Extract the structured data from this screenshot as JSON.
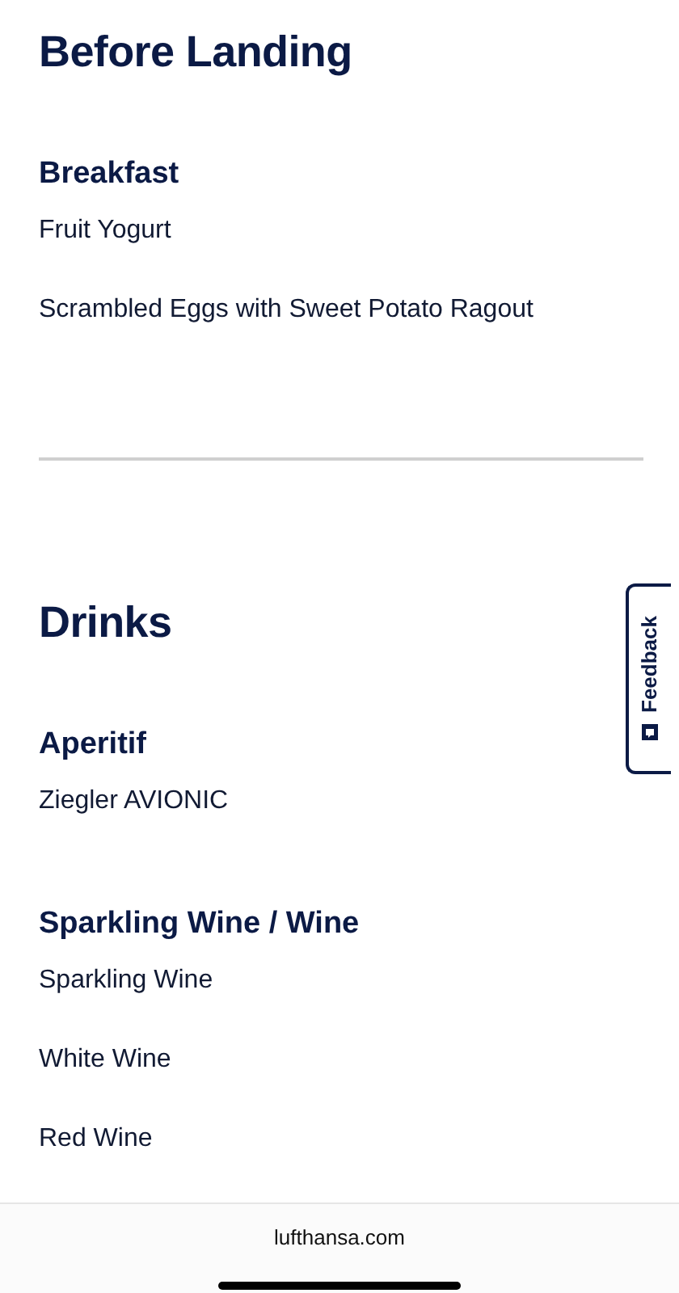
{
  "sections": [
    {
      "title": "Before Landing",
      "groups": [
        {
          "heading": "Breakfast",
          "items": [
            "Fruit Yogurt",
            "Scrambled Eggs with Sweet Potato Ragout"
          ]
        }
      ]
    },
    {
      "title": "Drinks",
      "groups": [
        {
          "heading": "Aperitif",
          "items": [
            "Ziegler AVIONIC"
          ]
        },
        {
          "heading": "Sparkling Wine / Wine",
          "items": [
            "Sparkling Wine",
            "White Wine",
            "Red Wine"
          ]
        }
      ]
    }
  ],
  "feedback_tab": {
    "label": "Feedback"
  },
  "browser_bar": {
    "url": "lufthansa.com"
  }
}
